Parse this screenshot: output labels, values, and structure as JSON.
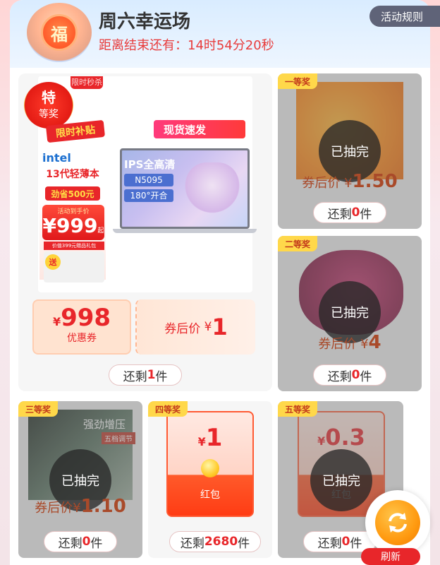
{
  "header": {
    "title": "周六幸运场",
    "countdown_label": "距离结束还有：",
    "countdown_value": "14时54分20秒",
    "fu_char": "福",
    "rules_button": "活动规则"
  },
  "special_prize": {
    "badge_main": "特",
    "badge_sub": "等奖",
    "ribbon": "限时补贴",
    "corner_tag": "限时秒杀",
    "brand": "intel",
    "laptop_title": "13代轻薄本",
    "discount": "劲省500元",
    "price_caption": "活动到手价",
    "price": "¥999",
    "price_suffix": "起",
    "gift_strip": "价值399元赠品礼包",
    "gift_label": "送",
    "ship_tag": "现货速发",
    "screen_label": "IPS全高清",
    "cpu_label": "N5095",
    "hinge_label": "180°开合",
    "coupon_value_symbol": "¥",
    "coupon_value": "998",
    "coupon_label": "优惠券",
    "after_price_label": "券后价",
    "after_price_symbol": "¥",
    "after_price_value": "1",
    "remain_prefix": "还剩",
    "remain_count": "1",
    "remain_suffix": "件"
  },
  "prizes": [
    {
      "rank": "一等奖",
      "status": "已抽完",
      "after_price_label": "券后价",
      "after_price_symbol": "¥",
      "after_price_value": "1.50",
      "remain_prefix": "还剩",
      "remain_count": "0",
      "remain_suffix": "件"
    },
    {
      "rank": "二等奖",
      "status": "已抽完",
      "after_price_label": "券后价",
      "after_price_symbol": "¥",
      "after_price_value": "4",
      "remain_prefix": "还剩",
      "remain_count": "0",
      "remain_suffix": "件"
    },
    {
      "rank": "三等奖",
      "status": "已抽完",
      "overlay_text_1": "强劲增压",
      "overlay_text_2": "五档调节",
      "after_price_label": "券后价",
      "after_price_symbol": "¥",
      "after_price_value": "1.10",
      "remain_prefix": "还剩",
      "remain_count": "0",
      "remain_suffix": "件"
    },
    {
      "rank": "四等奖",
      "symbol": "¥",
      "value": "1",
      "label": "红包",
      "remain_prefix": "还剩",
      "remain_count": "2680",
      "remain_suffix": "件"
    },
    {
      "rank": "五等奖",
      "status": "已抽完",
      "symbol": "¥",
      "value": "0.3",
      "label": "红包",
      "remain_prefix": "还剩",
      "remain_count": "0",
      "remain_suffix": "件"
    }
  ],
  "refresh": {
    "label": "刷新"
  },
  "colors": {
    "accent": "#e8262a",
    "grey_tile": "#f0f0f0",
    "rules_bg": "#5f6378"
  }
}
